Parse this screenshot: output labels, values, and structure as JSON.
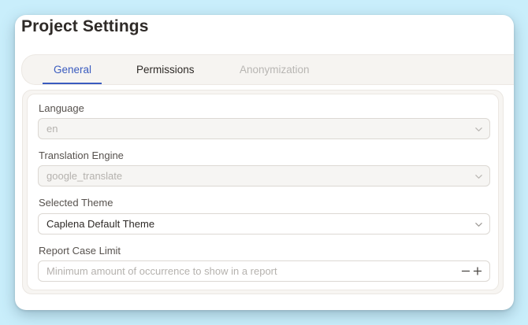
{
  "page": {
    "title": "Project Settings"
  },
  "tabs": [
    {
      "label": "General",
      "state": "active"
    },
    {
      "label": "Permissions",
      "state": "normal"
    },
    {
      "label": "Anonymization",
      "state": "disabled"
    }
  ],
  "form": {
    "language": {
      "label": "Language",
      "value": "en",
      "disabled": true
    },
    "translation_engine": {
      "label": "Translation Engine",
      "value": "google_translate",
      "disabled": true
    },
    "selected_theme": {
      "label": "Selected Theme",
      "value": "Caplena Default Theme",
      "disabled": false
    },
    "report_case_limit": {
      "label": "Report Case Limit",
      "value": "",
      "placeholder": "Minimum amount of occurrence to show in a report"
    }
  },
  "icons": {
    "chevron": "chevron-down-icon",
    "minus": "minus-icon",
    "plus": "plus-icon"
  },
  "colors": {
    "background": "#c9eefb",
    "accent": "#3a5bbf",
    "text": "#2e2a27",
    "disabled_text": "#b5b2ae"
  }
}
